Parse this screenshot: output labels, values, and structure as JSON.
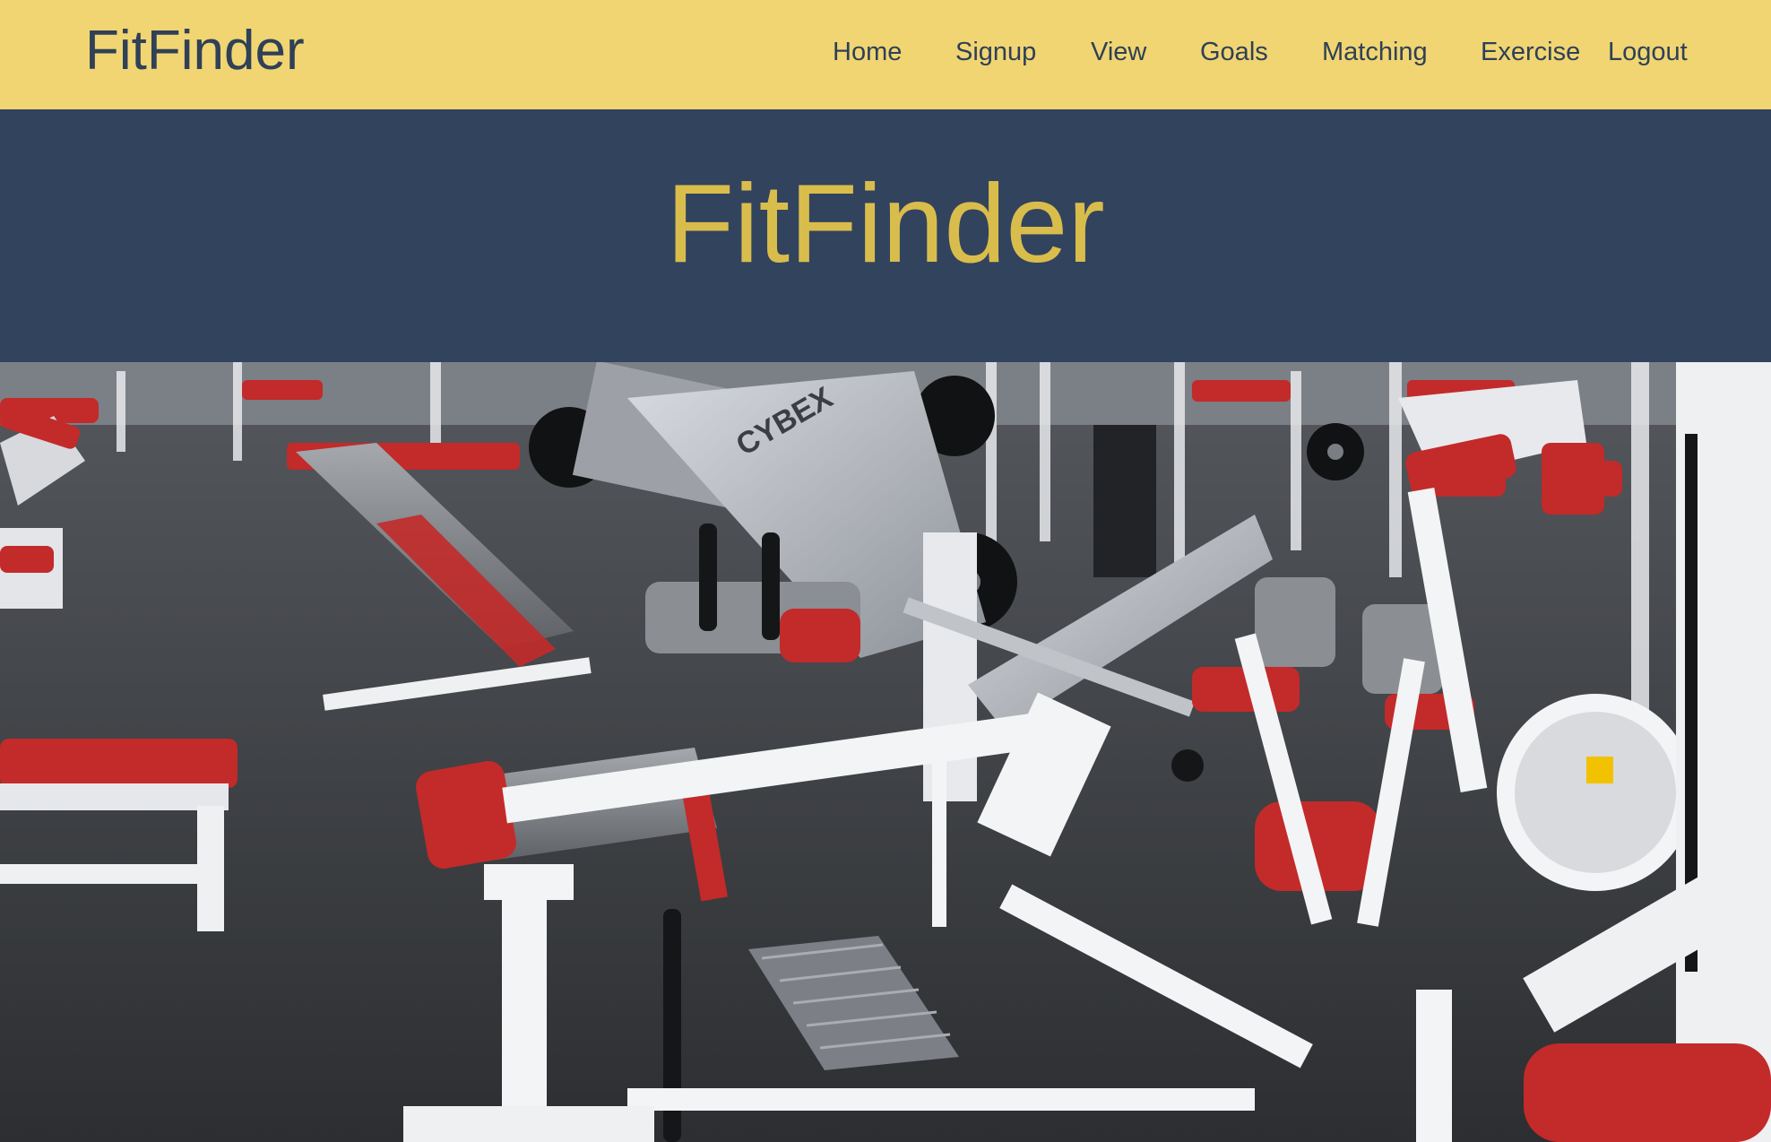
{
  "navbar": {
    "brand": "FitFinder",
    "links": [
      {
        "label": "Home"
      },
      {
        "label": "Signup"
      },
      {
        "label": "View"
      },
      {
        "label": "Goals"
      },
      {
        "label": "Matching"
      },
      {
        "label": "Exercise"
      },
      {
        "label": "Logout"
      }
    ]
  },
  "hero": {
    "title": "FitFinder"
  },
  "colors": {
    "navbar_bg": "#f0d572",
    "nav_text": "#2f4057",
    "hero_bg": "#32435e",
    "hero_title": "#d9bd4c"
  },
  "image": {
    "subject": "gym-equipment-photo",
    "embedded_text": [
      "CYBEX"
    ]
  }
}
